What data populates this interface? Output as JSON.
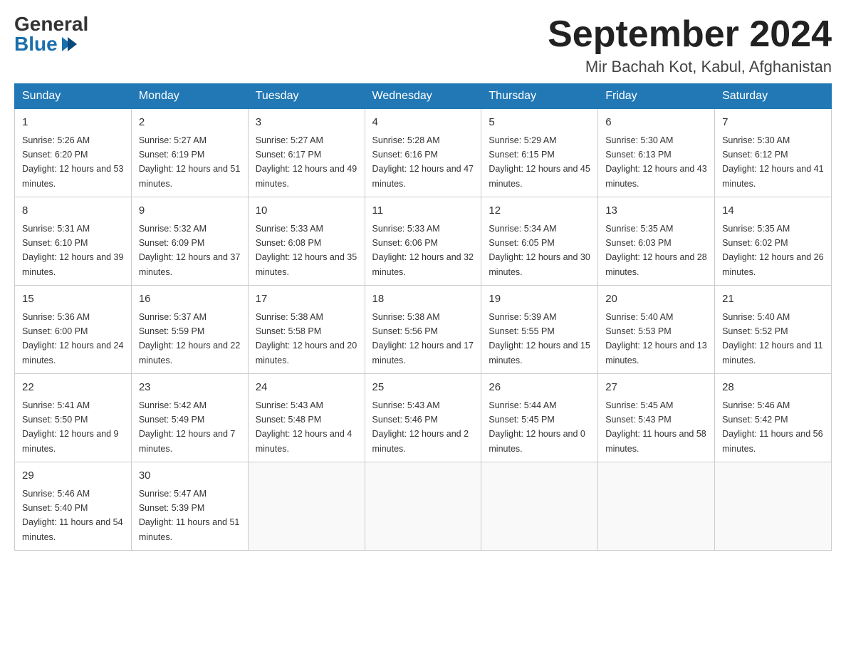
{
  "logo": {
    "general": "General",
    "blue": "Blue"
  },
  "header": {
    "month_year": "September 2024",
    "location": "Mir Bachah Kot, Kabul, Afghanistan"
  },
  "weekdays": [
    "Sunday",
    "Monday",
    "Tuesday",
    "Wednesday",
    "Thursday",
    "Friday",
    "Saturday"
  ],
  "weeks": [
    [
      {
        "day": "1",
        "sunrise": "5:26 AM",
        "sunset": "6:20 PM",
        "daylight": "12 hours and 53 minutes."
      },
      {
        "day": "2",
        "sunrise": "5:27 AM",
        "sunset": "6:19 PM",
        "daylight": "12 hours and 51 minutes."
      },
      {
        "day": "3",
        "sunrise": "5:27 AM",
        "sunset": "6:17 PM",
        "daylight": "12 hours and 49 minutes."
      },
      {
        "day": "4",
        "sunrise": "5:28 AM",
        "sunset": "6:16 PM",
        "daylight": "12 hours and 47 minutes."
      },
      {
        "day": "5",
        "sunrise": "5:29 AM",
        "sunset": "6:15 PM",
        "daylight": "12 hours and 45 minutes."
      },
      {
        "day": "6",
        "sunrise": "5:30 AM",
        "sunset": "6:13 PM",
        "daylight": "12 hours and 43 minutes."
      },
      {
        "day": "7",
        "sunrise": "5:30 AM",
        "sunset": "6:12 PM",
        "daylight": "12 hours and 41 minutes."
      }
    ],
    [
      {
        "day": "8",
        "sunrise": "5:31 AM",
        "sunset": "6:10 PM",
        "daylight": "12 hours and 39 minutes."
      },
      {
        "day": "9",
        "sunrise": "5:32 AM",
        "sunset": "6:09 PM",
        "daylight": "12 hours and 37 minutes."
      },
      {
        "day": "10",
        "sunrise": "5:33 AM",
        "sunset": "6:08 PM",
        "daylight": "12 hours and 35 minutes."
      },
      {
        "day": "11",
        "sunrise": "5:33 AM",
        "sunset": "6:06 PM",
        "daylight": "12 hours and 32 minutes."
      },
      {
        "day": "12",
        "sunrise": "5:34 AM",
        "sunset": "6:05 PM",
        "daylight": "12 hours and 30 minutes."
      },
      {
        "day": "13",
        "sunrise": "5:35 AM",
        "sunset": "6:03 PM",
        "daylight": "12 hours and 28 minutes."
      },
      {
        "day": "14",
        "sunrise": "5:35 AM",
        "sunset": "6:02 PM",
        "daylight": "12 hours and 26 minutes."
      }
    ],
    [
      {
        "day": "15",
        "sunrise": "5:36 AM",
        "sunset": "6:00 PM",
        "daylight": "12 hours and 24 minutes."
      },
      {
        "day": "16",
        "sunrise": "5:37 AM",
        "sunset": "5:59 PM",
        "daylight": "12 hours and 22 minutes."
      },
      {
        "day": "17",
        "sunrise": "5:38 AM",
        "sunset": "5:58 PM",
        "daylight": "12 hours and 20 minutes."
      },
      {
        "day": "18",
        "sunrise": "5:38 AM",
        "sunset": "5:56 PM",
        "daylight": "12 hours and 17 minutes."
      },
      {
        "day": "19",
        "sunrise": "5:39 AM",
        "sunset": "5:55 PM",
        "daylight": "12 hours and 15 minutes."
      },
      {
        "day": "20",
        "sunrise": "5:40 AM",
        "sunset": "5:53 PM",
        "daylight": "12 hours and 13 minutes."
      },
      {
        "day": "21",
        "sunrise": "5:40 AM",
        "sunset": "5:52 PM",
        "daylight": "12 hours and 11 minutes."
      }
    ],
    [
      {
        "day": "22",
        "sunrise": "5:41 AM",
        "sunset": "5:50 PM",
        "daylight": "12 hours and 9 minutes."
      },
      {
        "day": "23",
        "sunrise": "5:42 AM",
        "sunset": "5:49 PM",
        "daylight": "12 hours and 7 minutes."
      },
      {
        "day": "24",
        "sunrise": "5:43 AM",
        "sunset": "5:48 PM",
        "daylight": "12 hours and 4 minutes."
      },
      {
        "day": "25",
        "sunrise": "5:43 AM",
        "sunset": "5:46 PM",
        "daylight": "12 hours and 2 minutes."
      },
      {
        "day": "26",
        "sunrise": "5:44 AM",
        "sunset": "5:45 PM",
        "daylight": "12 hours and 0 minutes."
      },
      {
        "day": "27",
        "sunrise": "5:45 AM",
        "sunset": "5:43 PM",
        "daylight": "11 hours and 58 minutes."
      },
      {
        "day": "28",
        "sunrise": "5:46 AM",
        "sunset": "5:42 PM",
        "daylight": "11 hours and 56 minutes."
      }
    ],
    [
      {
        "day": "29",
        "sunrise": "5:46 AM",
        "sunset": "5:40 PM",
        "daylight": "11 hours and 54 minutes."
      },
      {
        "day": "30",
        "sunrise": "5:47 AM",
        "sunset": "5:39 PM",
        "daylight": "11 hours and 51 minutes."
      },
      null,
      null,
      null,
      null,
      null
    ]
  ]
}
